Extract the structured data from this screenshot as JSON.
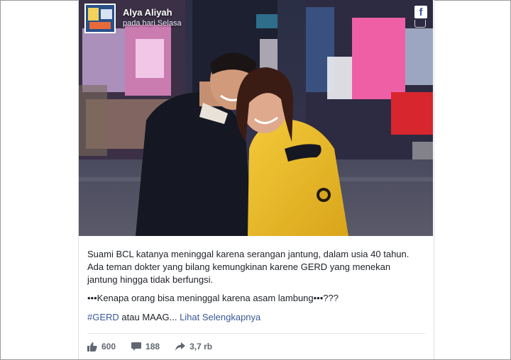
{
  "post": {
    "author": "Alya Aliyah",
    "time": "pada hari Selasa",
    "paragraph1": "Suami BCL katanya meninggal karena serangan jantung, dalam usia 40 tahun. Ada teman dokter yang bilang kemungkinan karene GERD yang menekan jantung hingga tidak berfungsi.",
    "paragraph2": "•••Kenapa orang bisa meninggal karena asam lambung•••???",
    "hashtag": "#GERD",
    "tag_middle": " atau MAAG... ",
    "see_more": "Lihat Selengkapnya",
    "fb_letter": "f"
  },
  "stats": {
    "likes": "600",
    "comments": "188",
    "shares": "3,7 rb"
  },
  "colors": {
    "link": "#385898",
    "facebook": "#3b5998",
    "text": "#1d2129",
    "muted": "#606770"
  }
}
